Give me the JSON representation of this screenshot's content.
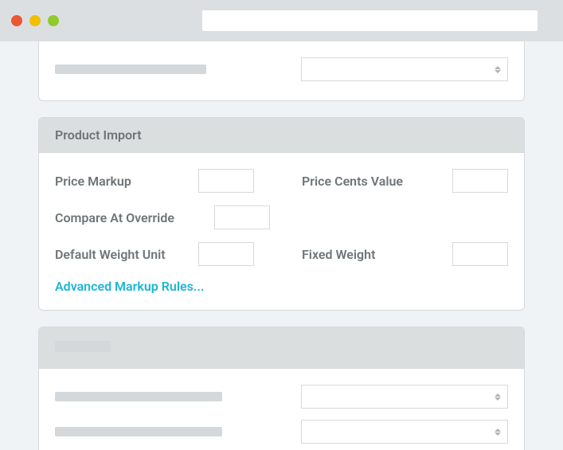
{
  "section_product_import": {
    "title": "Product Import",
    "price_markup_label": "Price Markup",
    "price_cents_label": "Price Cents Value",
    "compare_at_label": "Compare At Override",
    "default_weight_label": "Default Weight Unit",
    "fixed_weight_label": "Fixed Weight",
    "advanced_link": "Advanced Markup Rules..."
  }
}
